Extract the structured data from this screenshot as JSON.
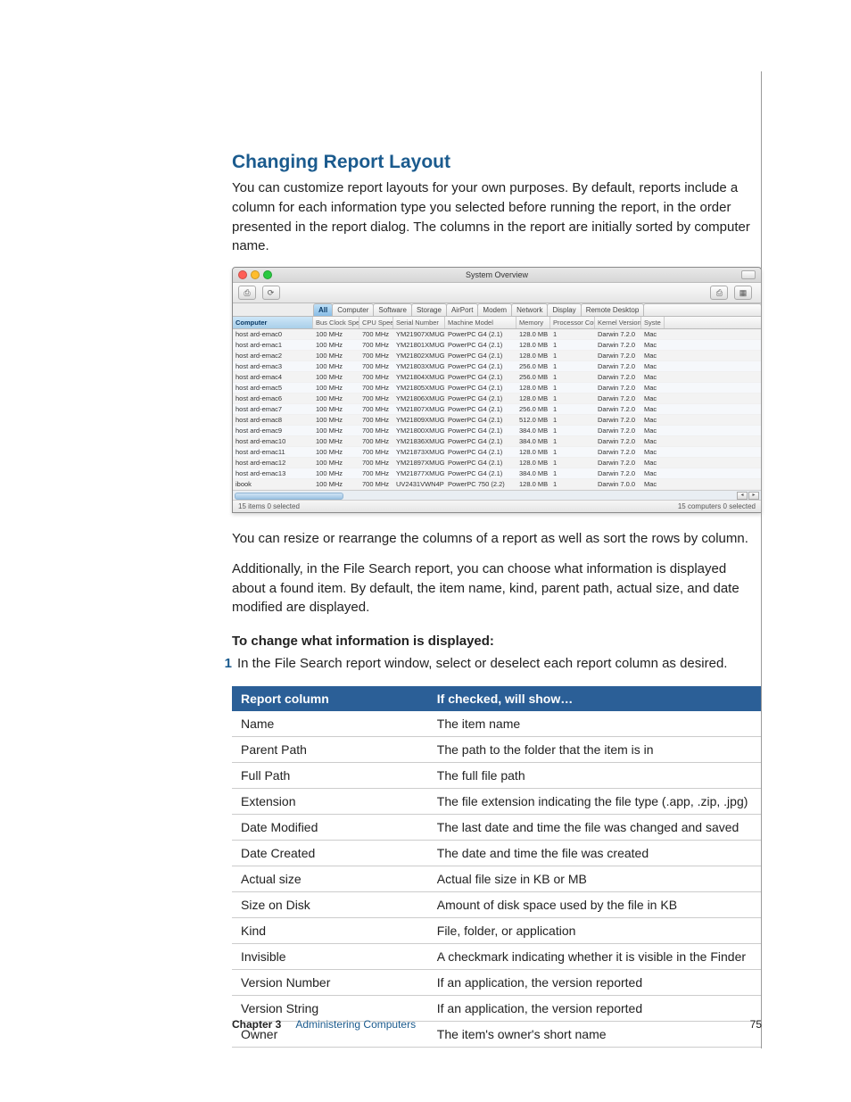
{
  "heading": "Changing Report Layout",
  "paragraphs": {
    "intro": "You can customize report layouts for your own purposes. By default, reports include a column for each information type you selected before running the report, in the order presented in the report dialog. The columns in the report are initially sorted by computer name.",
    "resize": "You can resize or rearrange the columns of a report as well as sort the rows by column.",
    "filesearch": "Additionally, in the File Search report, you can choose what information is displayed about a found item. By default, the item name, kind, parent path, actual size, and date modified are displayed."
  },
  "subhead": "To change what information is displayed:",
  "step1": "In the File Search report window, select or deselect each report column as desired.",
  "window": {
    "title": "System Overview",
    "tabs": [
      "All",
      "Computer",
      "Software",
      "Storage",
      "AirPort",
      "Modem",
      "Network",
      "Display",
      "Remote Desktop"
    ],
    "columns": [
      "Computer",
      "Bus Clock Speed",
      "CPU Speed",
      "Serial Number",
      "Machine Model",
      "Memory",
      "Processor Count",
      "Kernel Version",
      "Syste"
    ],
    "rows": [
      [
        "host ard-emac0",
        "100 MHz",
        "700 MHz",
        "YM21907XMUG",
        "PowerPC G4  (2.1)",
        "128.0 MB",
        "1",
        "Darwin 7.2.0",
        "Mac"
      ],
      [
        "host ard-emac1",
        "100 MHz",
        "700 MHz",
        "YM21801XMUG",
        "PowerPC G4  (2.1)",
        "128.0 MB",
        "1",
        "Darwin 7.2.0",
        "Mac"
      ],
      [
        "host ard-emac2",
        "100 MHz",
        "700 MHz",
        "YM21802XMUG",
        "PowerPC G4  (2.1)",
        "128.0 MB",
        "1",
        "Darwin 7.2.0",
        "Mac"
      ],
      [
        "host ard-emac3",
        "100 MHz",
        "700 MHz",
        "YM21803XMUG",
        "PowerPC G4  (2.1)",
        "256.0 MB",
        "1",
        "Darwin 7.2.0",
        "Mac"
      ],
      [
        "host ard-emac4",
        "100 MHz",
        "700 MHz",
        "YM21804XMUG",
        "PowerPC G4  (2.1)",
        "256.0 MB",
        "1",
        "Darwin 7.2.0",
        "Mac"
      ],
      [
        "host ard-emac5",
        "100 MHz",
        "700 MHz",
        "YM21805XMUG",
        "PowerPC G4  (2.1)",
        "128.0 MB",
        "1",
        "Darwin 7.2.0",
        "Mac"
      ],
      [
        "host ard-emac6",
        "100 MHz",
        "700 MHz",
        "YM21806XMUG",
        "PowerPC G4  (2.1)",
        "128.0 MB",
        "1",
        "Darwin 7.2.0",
        "Mac"
      ],
      [
        "host ard-emac7",
        "100 MHz",
        "700 MHz",
        "YM21807XMUG",
        "PowerPC G4  (2.1)",
        "256.0 MB",
        "1",
        "Darwin 7.2.0",
        "Mac"
      ],
      [
        "host ard-emac8",
        "100 MHz",
        "700 MHz",
        "YM21809XMUG",
        "PowerPC G4  (2.1)",
        "512.0 MB",
        "1",
        "Darwin 7.2.0",
        "Mac"
      ],
      [
        "host ard-emac9",
        "100 MHz",
        "700 MHz",
        "YM21800XMUG",
        "PowerPC G4  (2.1)",
        "384.0 MB",
        "1",
        "Darwin 7.2.0",
        "Mac"
      ],
      [
        "host ard-emac10",
        "100 MHz",
        "700 MHz",
        "YM21836XMUG",
        "PowerPC G4  (2.1)",
        "384.0 MB",
        "1",
        "Darwin 7.2.0",
        "Mac"
      ],
      [
        "host ard-emac11",
        "100 MHz",
        "700 MHz",
        "YM21873XMUG",
        "PowerPC G4  (2.1)",
        "128.0 MB",
        "1",
        "Darwin 7.2.0",
        "Mac"
      ],
      [
        "host ard-emac12",
        "100 MHz",
        "700 MHz",
        "YM21897XMUG",
        "PowerPC G4  (2.1)",
        "128.0 MB",
        "1",
        "Darwin 7.2.0",
        "Mac"
      ],
      [
        "host ard-emac13",
        "100 MHz",
        "700 MHz",
        "YM21877XMUG",
        "PowerPC G4  (2.1)",
        "384.0 MB",
        "1",
        "Darwin 7.2.0",
        "Mac"
      ],
      [
        "ibook",
        "100 MHz",
        "700 MHz",
        "UV2431VWN4P",
        "PowerPC 750 (2.2)",
        "128.0 MB",
        "1",
        "Darwin 7.0.0",
        "Mac"
      ]
    ],
    "status_left": "15 items   0 selected",
    "status_right": "15 computers   0 selected"
  },
  "defs_header": {
    "col1": "Report column",
    "col2": "If checked, will show…"
  },
  "defs": [
    [
      "Name",
      "The item name"
    ],
    [
      "Parent Path",
      "The path to the folder that the item is in"
    ],
    [
      "Full Path",
      "The full file path"
    ],
    [
      "Extension",
      "The file extension indicating the file type (.app, .zip, .jpg)"
    ],
    [
      "Date Modified",
      "The last date and time the file was changed and saved"
    ],
    [
      "Date Created",
      "The date and time the file was created"
    ],
    [
      "Actual size",
      "Actual file size in KB or MB"
    ],
    [
      "Size on Disk",
      "Amount of disk space used by the file in KB"
    ],
    [
      "Kind",
      "File, folder, or application"
    ],
    [
      "Invisible",
      "A checkmark indicating whether it is visible in the Finder"
    ],
    [
      "Version Number",
      "If an application, the version reported"
    ],
    [
      "Version String",
      "If an application, the version reported"
    ],
    [
      "Owner",
      "The item's owner's short name"
    ]
  ],
  "footer": {
    "chapter_label": "Chapter 3",
    "chapter_name": "Administering Computers",
    "page_number": "75"
  }
}
